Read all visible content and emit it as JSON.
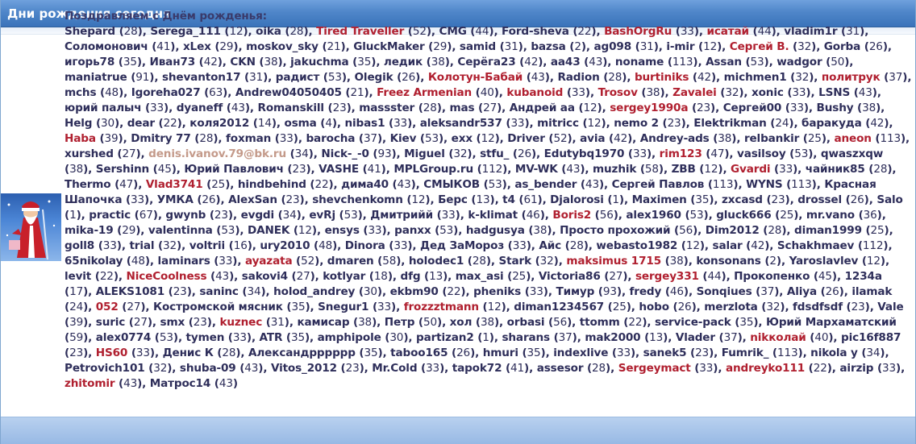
{
  "panel": {
    "title": "Дни рождения сегодня",
    "intro": "Поздравляем с Днём рожденья:"
  },
  "users": [
    {
      "n": "Shepard",
      "a": "28"
    },
    {
      "n": "Serega_111",
      "a": "12"
    },
    {
      "n": "oika",
      "a": "28"
    },
    {
      "n": "Tired Traveller",
      "a": "52",
      "c": "r"
    },
    {
      "n": "CMG",
      "a": "44"
    },
    {
      "n": "Ford-sheva",
      "a": "22"
    },
    {
      "n": "BashOrgRu",
      "a": "33",
      "c": "r"
    },
    {
      "n": "исатай",
      "a": "44",
      "c": "r"
    },
    {
      "n": "vladim1r",
      "a": "31"
    },
    {
      "n": "Соломонович",
      "a": "41"
    },
    {
      "n": "xLex",
      "a": "29"
    },
    {
      "n": "moskov_sky",
      "a": "21"
    },
    {
      "n": "GluckMaker",
      "a": "29"
    },
    {
      "n": "samid",
      "a": "31"
    },
    {
      "n": "bazsa",
      "a": "2"
    },
    {
      "n": "ag098",
      "a": "31"
    },
    {
      "n": "i-mir",
      "a": "12"
    },
    {
      "n": "Сергей В.",
      "a": "32",
      "c": "r"
    },
    {
      "n": "Gorba",
      "a": "26"
    },
    {
      "n": "игорь78",
      "a": "35"
    },
    {
      "n": "Иван73",
      "a": "42"
    },
    {
      "n": "CKN",
      "a": "38"
    },
    {
      "n": "jakuchma",
      "a": "35"
    },
    {
      "n": "ледик",
      "a": "38"
    },
    {
      "n": "Серёга23",
      "a": "42"
    },
    {
      "n": "aa43",
      "a": "43"
    },
    {
      "n": "noname",
      "a": "113"
    },
    {
      "n": "Assan",
      "a": "53"
    },
    {
      "n": "wadgor",
      "a": "50"
    },
    {
      "n": "maniatrue",
      "a": "91"
    },
    {
      "n": "shevanton17",
      "a": "31"
    },
    {
      "n": "радист",
      "a": "53"
    },
    {
      "n": "Olegik",
      "a": "26"
    },
    {
      "n": "Колотун-Бабай",
      "a": "43",
      "c": "r"
    },
    {
      "n": "Radion",
      "a": "28"
    },
    {
      "n": "burtiniks",
      "a": "42",
      "c": "r"
    },
    {
      "n": "michmen1",
      "a": "32"
    },
    {
      "n": "политрук",
      "a": "37",
      "c": "r"
    },
    {
      "n": "mchs",
      "a": "48"
    },
    {
      "n": "Igoreha027",
      "a": "63"
    },
    {
      "n": "Andrew04050405",
      "a": "21"
    },
    {
      "n": "Freez Armenian",
      "a": "40",
      "c": "r"
    },
    {
      "n": "kubanoid",
      "a": "33",
      "c": "r"
    },
    {
      "n": "Trosov",
      "a": "38",
      "c": "r"
    },
    {
      "n": "Zavalei",
      "a": "32",
      "c": "r"
    },
    {
      "n": "xonic",
      "a": "33"
    },
    {
      "n": "LSNS",
      "a": "43"
    },
    {
      "n": "юрий палыч",
      "a": "33"
    },
    {
      "n": "dyaneff",
      "a": "43"
    },
    {
      "n": "Romanskill",
      "a": "23"
    },
    {
      "n": "massster",
      "a": "28"
    },
    {
      "n": "mas",
      "a": "27"
    },
    {
      "n": "Андрей aa",
      "a": "12"
    },
    {
      "n": "sergey1990a",
      "a": "23",
      "c": "r"
    },
    {
      "n": "Сергей00",
      "a": "33"
    },
    {
      "n": "Bushy",
      "a": "38"
    },
    {
      "n": "Helg",
      "a": "30"
    },
    {
      "n": "dear",
      "a": "22"
    },
    {
      "n": "коля2012",
      "a": "14"
    },
    {
      "n": "osma",
      "a": "4"
    },
    {
      "n": "nibas1",
      "a": "33"
    },
    {
      "n": "aleksandr537",
      "a": "33"
    },
    {
      "n": "mitricc",
      "a": "12"
    },
    {
      "n": "nemo 2",
      "a": "23"
    },
    {
      "n": "Elektrikman",
      "a": "24"
    },
    {
      "n": "баракуда",
      "a": "42"
    },
    {
      "n": "Haba",
      "a": "39",
      "c": "r"
    },
    {
      "n": "Dmitry 77",
      "a": "28"
    },
    {
      "n": "foxman",
      "a": "33"
    },
    {
      "n": "barocha",
      "a": "37"
    },
    {
      "n": "Kiev",
      "a": "53"
    },
    {
      "n": "exx",
      "a": "12"
    },
    {
      "n": "Driver",
      "a": "52"
    },
    {
      "n": "avia",
      "a": "42"
    },
    {
      "n": "Andrey-ads",
      "a": "38"
    },
    {
      "n": "relbankir",
      "a": "25"
    },
    {
      "n": "aneon",
      "a": "113",
      "c": "r"
    },
    {
      "n": "xurshed",
      "a": "27"
    },
    {
      "n": "denis.ivanov.79@bk.ru",
      "a": "34",
      "c": "e"
    },
    {
      "n": "Nick-_-0",
      "a": "93"
    },
    {
      "n": "Miguel",
      "a": "32"
    },
    {
      "n": "stfu_",
      "a": "26"
    },
    {
      "n": "Edutybq1970",
      "a": "33"
    },
    {
      "n": "rim123",
      "a": "47",
      "c": "r"
    },
    {
      "n": "vasilsoy",
      "a": "53"
    },
    {
      "n": "qwaszxqw",
      "a": "38"
    },
    {
      "n": "Sershinn",
      "a": "45"
    },
    {
      "n": "Юрий Павлович",
      "a": "23"
    },
    {
      "n": "VASHE",
      "a": "41"
    },
    {
      "n": "MPLGroup.ru",
      "a": "112"
    },
    {
      "n": "MV-WK",
      "a": "43"
    },
    {
      "n": "muzhik",
      "a": "58"
    },
    {
      "n": "ZBB",
      "a": "12"
    },
    {
      "n": "Gvardi",
      "a": "33",
      "c": "r"
    },
    {
      "n": "чайник85",
      "a": "28"
    },
    {
      "n": "Thermo",
      "a": "47"
    },
    {
      "n": "Vlad3741",
      "a": "25",
      "c": "r"
    },
    {
      "n": "hindbehind",
      "a": "22"
    },
    {
      "n": "дима40",
      "a": "43"
    },
    {
      "n": "СМЫКОВ",
      "a": "53"
    },
    {
      "n": "as_bender",
      "a": "43"
    },
    {
      "n": "Сергей Павлов",
      "a": "113"
    },
    {
      "n": "WYNS",
      "a": "113"
    },
    {
      "n": "Красная Шапочка",
      "a": "33"
    },
    {
      "n": "УМКА",
      "a": "26"
    },
    {
      "n": "AlexSan",
      "a": "23"
    },
    {
      "n": "shevchenkomn",
      "a": "12"
    },
    {
      "n": "Берс",
      "a": "13"
    },
    {
      "n": "t4",
      "a": "61"
    },
    {
      "n": "Djalorosi",
      "a": "1"
    },
    {
      "n": "Maximen",
      "a": "35"
    },
    {
      "n": "zxcasd",
      "a": "23"
    },
    {
      "n": "drossel",
      "a": "26"
    },
    {
      "n": "Salo",
      "a": "1"
    },
    {
      "n": "practic",
      "a": "67"
    },
    {
      "n": "gwynb",
      "a": "23"
    },
    {
      "n": "evgdi",
      "a": "34"
    },
    {
      "n": "evRj",
      "a": "53"
    },
    {
      "n": "Дмитрийй",
      "a": "33"
    },
    {
      "n": "k-klimat",
      "a": "46"
    },
    {
      "n": "Boris2",
      "a": "56",
      "c": "r"
    },
    {
      "n": "alex1960",
      "a": "53"
    },
    {
      "n": "gluck666",
      "a": "25"
    },
    {
      "n": "mr.vano",
      "a": "36"
    },
    {
      "n": "mika-19",
      "a": "29"
    },
    {
      "n": "valentinna",
      "a": "53"
    },
    {
      "n": "DANEK",
      "a": "12"
    },
    {
      "n": "ensys",
      "a": "33"
    },
    {
      "n": "panxx",
      "a": "53"
    },
    {
      "n": "hadgusya",
      "a": "38"
    },
    {
      "n": "Просто прохожий",
      "a": "56"
    },
    {
      "n": "Dim2012",
      "a": "28"
    },
    {
      "n": "diman1999",
      "a": "25"
    },
    {
      "n": "goll8",
      "a": "33"
    },
    {
      "n": "trial",
      "a": "32"
    },
    {
      "n": "voltrii",
      "a": "16"
    },
    {
      "n": "ury2010",
      "a": "48"
    },
    {
      "n": "Dinora",
      "a": "33"
    },
    {
      "n": "Дед ЗаМороз",
      "a": "33"
    },
    {
      "n": "Айс",
      "a": "28"
    },
    {
      "n": "webasto1982",
      "a": "12"
    },
    {
      "n": "salar",
      "a": "42"
    },
    {
      "n": "Schakhmaev",
      "a": "112"
    },
    {
      "n": "65nikolay",
      "a": "48"
    },
    {
      "n": "laminars",
      "a": "33"
    },
    {
      "n": "ayazata",
      "a": "52",
      "c": "r"
    },
    {
      "n": "dmaren",
      "a": "58"
    },
    {
      "n": "holodec1",
      "a": "28"
    },
    {
      "n": "Stark",
      "a": "32"
    },
    {
      "n": "maksimus 1715",
      "a": "38",
      "c": "r"
    },
    {
      "n": "konsonans",
      "a": "2"
    },
    {
      "n": "Yaroslavlev",
      "a": "12"
    },
    {
      "n": "levit",
      "a": "22"
    },
    {
      "n": "NiceCoolness",
      "a": "43",
      "c": "r"
    },
    {
      "n": "sakovi4",
      "a": "27"
    },
    {
      "n": "kotlyar",
      "a": "18"
    },
    {
      "n": "dfg",
      "a": "13"
    },
    {
      "n": "max_asi",
      "a": "25"
    },
    {
      "n": "Victoria86",
      "a": "27"
    },
    {
      "n": "sergey331",
      "a": "44",
      "c": "r"
    },
    {
      "n": "Прокопенко",
      "a": "45"
    },
    {
      "n": "1234a",
      "a": "17"
    },
    {
      "n": "ALEKS1081",
      "a": "23"
    },
    {
      "n": "saninc",
      "a": "34"
    },
    {
      "n": "holod_andrey",
      "a": "30"
    },
    {
      "n": "ekbm90",
      "a": "22"
    },
    {
      "n": "pheniks",
      "a": "33"
    },
    {
      "n": "Тимур",
      "a": "93"
    },
    {
      "n": "fredy",
      "a": "46"
    },
    {
      "n": "Sonqiues",
      "a": "37"
    },
    {
      "n": "Aliya",
      "a": "26"
    },
    {
      "n": "ilamak",
      "a": "24"
    },
    {
      "n": "052",
      "a": "27",
      "c": "r"
    },
    {
      "n": "Костромской мясник",
      "a": "35"
    },
    {
      "n": "Snegur1",
      "a": "33"
    },
    {
      "n": "frozzztmann",
      "a": "12",
      "c": "r"
    },
    {
      "n": "diman1234567",
      "a": "25"
    },
    {
      "n": "hobo",
      "a": "26"
    },
    {
      "n": "merzlota",
      "a": "32"
    },
    {
      "n": "fdsdfsdf",
      "a": "23"
    },
    {
      "n": "Vale",
      "a": "39"
    },
    {
      "n": "suric",
      "a": "27"
    },
    {
      "n": "smx",
      "a": "23"
    },
    {
      "n": "kuznec",
      "a": "31",
      "c": "r"
    },
    {
      "n": "камисар",
      "a": "38"
    },
    {
      "n": "Петр",
      "a": "50"
    },
    {
      "n": "хол",
      "a": "38"
    },
    {
      "n": "orbasi",
      "a": "56"
    },
    {
      "n": "ttomm",
      "a": "22"
    },
    {
      "n": "service-pack",
      "a": "35"
    },
    {
      "n": "Юрий Мархаматский",
      "a": "59"
    },
    {
      "n": "alex0774",
      "a": "53"
    },
    {
      "n": "tymen",
      "a": "33"
    },
    {
      "n": "ATR",
      "a": "35"
    },
    {
      "n": "amphipole",
      "a": "30"
    },
    {
      "n": "partizan2",
      "a": "1"
    },
    {
      "n": "sharans",
      "a": "37"
    },
    {
      "n": "mak2000",
      "a": "13"
    },
    {
      "n": "Vlader",
      "a": "37"
    },
    {
      "n": "nikколай",
      "a": "40",
      "c": "r"
    },
    {
      "n": "pic16f887",
      "a": "23"
    },
    {
      "n": "HS60",
      "a": "33",
      "c": "r"
    },
    {
      "n": "Денис К",
      "a": "28"
    },
    {
      "n": "Александрррррр",
      "a": "35"
    },
    {
      "n": "taboo165",
      "a": "26"
    },
    {
      "n": "hmuri",
      "a": "35"
    },
    {
      "n": "indexlive",
      "a": "33"
    },
    {
      "n": "sanek5",
      "a": "23"
    },
    {
      "n": "Fumrik_",
      "a": "113"
    },
    {
      "n": "nikola y",
      "a": "34"
    },
    {
      "n": "Petrovich101",
      "a": "32"
    },
    {
      "n": "shuba-09",
      "a": "43"
    },
    {
      "n": "Vitos_2012",
      "a": "23"
    },
    {
      "n": "Mr.Cold",
      "a": "33"
    },
    {
      "n": "tapok72",
      "a": "41"
    },
    {
      "n": "assesor",
      "a": "28"
    },
    {
      "n": "Sergeymact",
      "a": "33",
      "c": "r"
    },
    {
      "n": "andreyko111",
      "a": "22",
      "c": "r"
    },
    {
      "n": "airzip",
      "a": "33"
    },
    {
      "n": "zhitomir",
      "a": "43",
      "c": "r"
    },
    {
      "n": "Матрос14",
      "a": "43"
    }
  ]
}
